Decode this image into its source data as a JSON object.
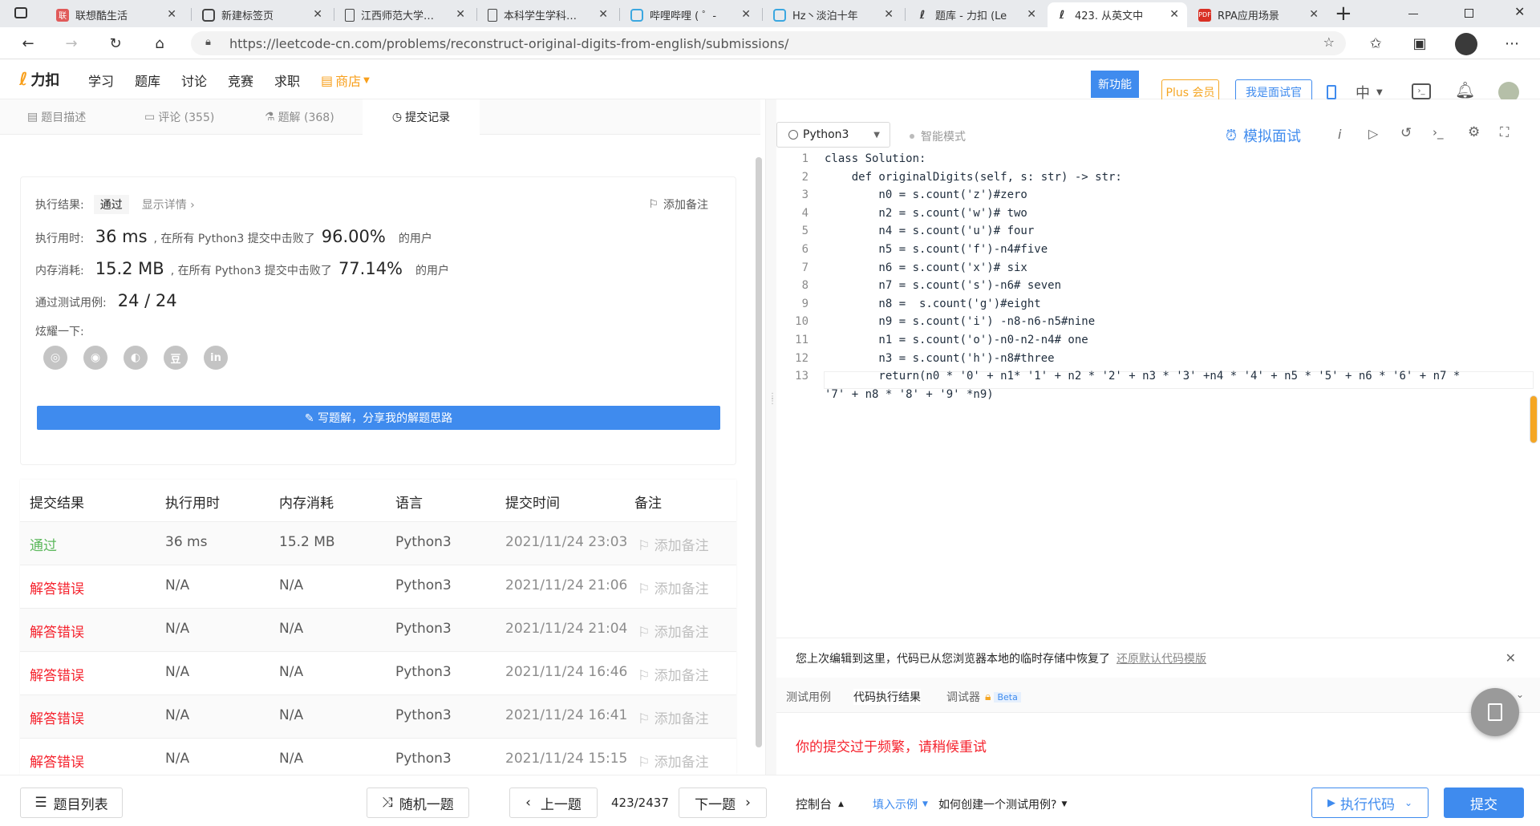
{
  "browser": {
    "tabs": [
      {
        "title": "联想酷生活"
      },
      {
        "title": "新建标签页"
      },
      {
        "title": "江西师范大学…"
      },
      {
        "title": "本科学生学科…"
      },
      {
        "title": "哔哩哔哩 ( ゜-"
      },
      {
        "title": "Hz丶淡泊十年"
      },
      {
        "title": "题库 - 力扣 (Le"
      },
      {
        "title": "423. 从英文中"
      },
      {
        "title": "RPA应用场景"
      }
    ],
    "new_tab": "+",
    "url": "https://leetcode-cn.com/problems/reconstruct-original-digits-from-english/submissions/"
  },
  "header": {
    "logo": "力扣",
    "nav": [
      "学习",
      "题库",
      "讨论",
      "竞赛",
      "求职",
      "商店"
    ],
    "new_feature": "新功能",
    "plus": "Plus 会员",
    "interviewer": "我是面试官",
    "lang_switch": "中"
  },
  "left_tabs": [
    "题目描述",
    "评论 (355)",
    "题解 (368)",
    "提交记录"
  ],
  "result": {
    "status_label": "执行结果:",
    "status": "通过",
    "details": "显示详情 ›",
    "add_note": "添加备注",
    "time_label": "执行用时:",
    "time_value": "36 ms",
    "time_mid": ", 在所有 Python3 提交中击败了",
    "time_pct": "96.00%",
    "time_tail": "的用户",
    "mem_label": "内存消耗:",
    "mem_value": "15.2 MB",
    "mem_mid": ", 在所有 Python3 提交中击败了",
    "mem_pct": "77.14%",
    "mem_tail": "的用户",
    "cases_label": "通过测试用例:",
    "cases_value": "24 / 24",
    "share_label": "炫耀一下:",
    "share_icons": [
      "wechat-icon",
      "weibo-icon",
      "qq-icon",
      "douban-icon",
      "linkedin-icon"
    ],
    "share_glyphs": [
      "◎",
      "◉",
      "◐",
      "豆",
      "in"
    ],
    "write_solution": "✎ 写题解，分享我的解题思路"
  },
  "table": {
    "headers": [
      "提交结果",
      "执行用时",
      "内存消耗",
      "语言",
      "提交时间",
      "备注"
    ],
    "rows": [
      {
        "result": "通过",
        "time": "36 ms",
        "mem": "15.2 MB",
        "lang": "Python3",
        "date": "2021/11/24 23:03",
        "note": "添加备注",
        "color": "#5cb85c"
      },
      {
        "result": "解答错误",
        "time": "N/A",
        "mem": "N/A",
        "lang": "Python3",
        "date": "2021/11/24 21:06",
        "note": "添加备注",
        "color": "#f5222d"
      },
      {
        "result": "解答错误",
        "time": "N/A",
        "mem": "N/A",
        "lang": "Python3",
        "date": "2021/11/24 21:04",
        "note": "添加备注",
        "color": "#f5222d"
      },
      {
        "result": "解答错误",
        "time": "N/A",
        "mem": "N/A",
        "lang": "Python3",
        "date": "2021/11/24 16:46",
        "note": "添加备注",
        "color": "#f5222d"
      },
      {
        "result": "解答错误",
        "time": "N/A",
        "mem": "N/A",
        "lang": "Python3",
        "date": "2021/11/24 16:41",
        "note": "添加备注",
        "color": "#f5222d"
      },
      {
        "result": "解答错误",
        "time": "N/A",
        "mem": "N/A",
        "lang": "Python3",
        "date": "2021/11/24 15:15",
        "note": "添加备注",
        "color": "#f5222d"
      }
    ]
  },
  "editor": {
    "language": "Python3",
    "smart_mode": "智能模式",
    "mock_interview": "模拟面试",
    "line_numbers": [
      "1",
      "2",
      "3",
      "4",
      "5",
      "6",
      "7",
      "8",
      "9",
      "10",
      "11",
      "12",
      "13"
    ],
    "lines": [
      "class Solution:",
      "    def originalDigits(self, s: str) -> str:",
      "        n0 = s.count('z')#zero",
      "        n2 = s.count('w')# two",
      "        n4 = s.count('u')# four",
      "        n5 = s.count('f')-n4#five",
      "        n6 = s.count('x')# six",
      "        n7 = s.count('s')-n6# seven",
      "        n8 =  s.count('g')#eight",
      "        n9 = s.count('i') -n8-n6-n5#nine",
      "        n1 = s.count('o')-n0-n2-n4# one",
      "        n3 = s.count('h')-n8#three",
      "        return(n0 * '0' + n1* '1' + n2 * '2' + n3 * '3' +n4 * '4' + n5 * '5' + n6 * '6' + n7 *",
      "'7' + n8 * '8' + '9' *n9)"
    ]
  },
  "restore": {
    "text": "您上次编辑到这里，代码已从您浏览器本地的临时存储中恢复了",
    "link": "还原默认代码模版"
  },
  "console": {
    "tabs": [
      "测试用例",
      "代码执行结果",
      "调试器"
    ],
    "beta": "Beta",
    "message": "你的提交过于频繁，请稍候重试"
  },
  "bottom": {
    "problem_list": "题目列表",
    "random": "随机一题",
    "prev": "上一题",
    "page": "423/2437",
    "next": "下一题",
    "console": "控制台",
    "fill_example": "填入示例",
    "how_create": "如何创建一个测试用例?",
    "run": "执行代码",
    "submit": "提交"
  }
}
